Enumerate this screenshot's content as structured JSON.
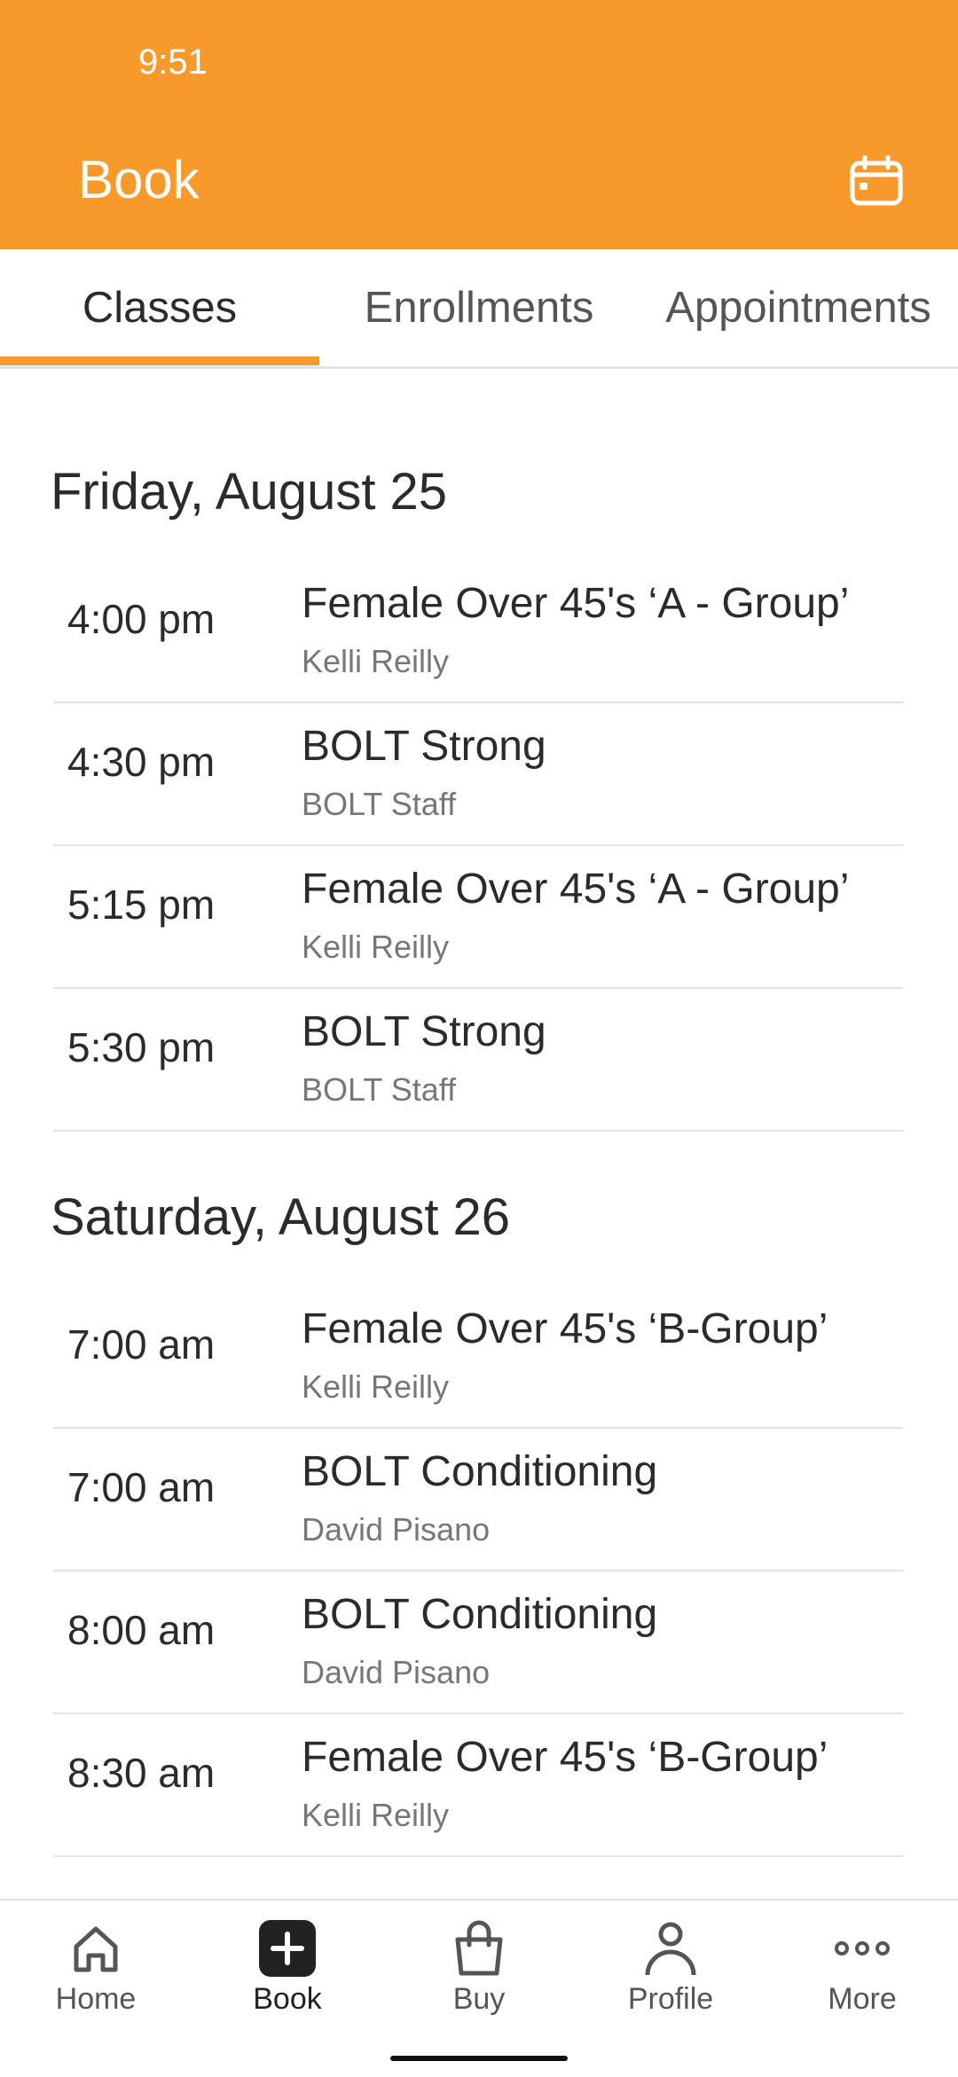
{
  "status_bar": {
    "time": "9:51"
  },
  "header": {
    "title": "Book",
    "calendar_icon": "calendar-icon",
    "background_color": "#F7992B"
  },
  "tabs": [
    {
      "label": "Classes",
      "active": true
    },
    {
      "label": "Enrollments",
      "active": false
    },
    {
      "label": "Appointments",
      "active": false
    }
  ],
  "days": [
    {
      "date": "Friday, August 25",
      "classes": [
        {
          "time": "4:00 pm",
          "name": "Female Over 45's ‘A - Group’",
          "instructor": "Kelli Reilly"
        },
        {
          "time": "4:30 pm",
          "name": "BOLT Strong",
          "instructor": "BOLT Staff"
        },
        {
          "time": "5:15 pm",
          "name": "Female Over 45's ‘A - Group’",
          "instructor": "Kelli Reilly"
        },
        {
          "time": "5:30 pm",
          "name": "BOLT Strong",
          "instructor": "BOLT Staff"
        }
      ]
    },
    {
      "date": "Saturday, August 26",
      "classes": [
        {
          "time": "7:00 am",
          "name": "Female Over 45's ‘B-Group’",
          "instructor": "Kelli Reilly"
        },
        {
          "time": "7:00 am",
          "name": "BOLT Conditioning",
          "instructor": "David Pisano"
        },
        {
          "time": "8:00 am",
          "name": "BOLT Conditioning",
          "instructor": "David Pisano"
        },
        {
          "time": "8:30 am",
          "name": "Female Over 45's ‘B-Group’",
          "instructor": "Kelli Reilly"
        }
      ]
    }
  ],
  "bottom_nav": [
    {
      "label": "Home",
      "icon": "home-icon",
      "active": false
    },
    {
      "label": "Book",
      "icon": "book-plus-icon",
      "active": true
    },
    {
      "label": "Buy",
      "icon": "shopping-bag-icon",
      "active": false
    },
    {
      "label": "Profile",
      "icon": "profile-icon",
      "active": false
    },
    {
      "label": "More",
      "icon": "more-dots-icon",
      "active": false
    }
  ]
}
